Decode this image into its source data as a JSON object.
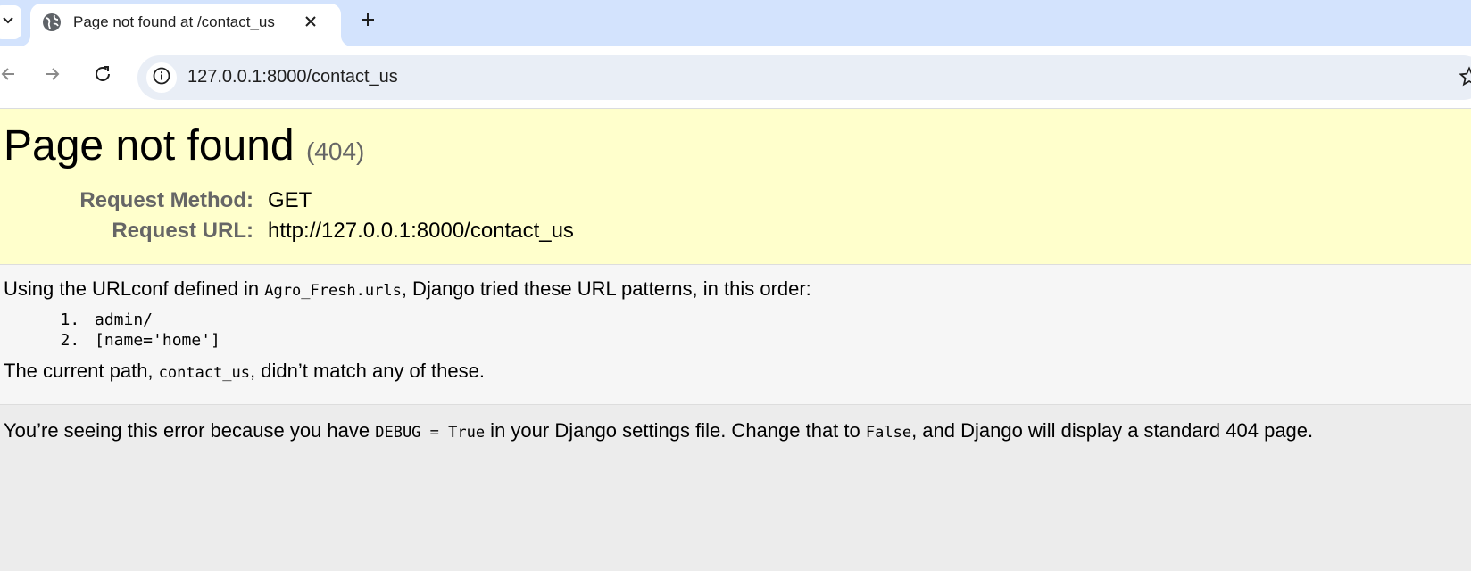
{
  "browser": {
    "tab": {
      "title": "Page not found at /contact_us"
    },
    "address_bar": {
      "url": "127.0.0.1:8000/contact_us"
    }
  },
  "page": {
    "heading": "Page not found",
    "status_code": "(404)",
    "request": {
      "method_label": "Request Method:",
      "method_value": "GET",
      "url_label": "Request URL:",
      "url_value": "http://127.0.0.1:8000/contact_us"
    },
    "info": {
      "intro_before": "Using the URLconf defined in ",
      "urlconf": "Agro_Fresh.urls",
      "intro_after": ", Django tried these URL patterns, in this order:",
      "patterns": [
        "admin/",
        "[name='home']"
      ],
      "current_before": "The current path, ",
      "current_path": "contact_us",
      "current_after": ", didn’t match any of these."
    },
    "explanation": {
      "part1": "You’re seeing this error because you have ",
      "debug_code": "DEBUG = True",
      "part2": " in your Django settings file. Change that to ",
      "false_code": "False",
      "part3": ", and Django will display a standard 404 page."
    }
  },
  "colors": {
    "tabstrip": "#d3e3fd",
    "summary_bg": "#ffffcc",
    "info_bg": "#f6f6f6",
    "page_bg": "#ececec",
    "label_gray": "#666666"
  },
  "icons": [
    "chevron-down-icon",
    "globe-icon",
    "close-icon",
    "plus-icon",
    "back-icon",
    "forward-icon",
    "reload-icon",
    "info-icon",
    "star-icon"
  ]
}
